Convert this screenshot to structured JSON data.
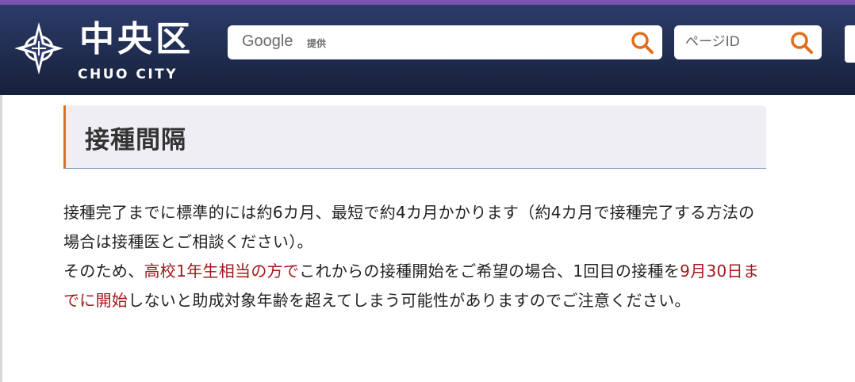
{
  "header": {
    "logo_kanji": "中央区",
    "logo_sub": "CHUO CITY",
    "search": {
      "google_label": "Google",
      "provided_label": "提供"
    },
    "page_id": {
      "placeholder": "ページID"
    }
  },
  "colors": {
    "accent_orange": "#e06e1e",
    "header_navy": "#1f2b4d",
    "stripe_purple": "#7b54b0",
    "emphasis_red": "#a3181c"
  },
  "main": {
    "heading": "接種間隔",
    "paragraph1": "接種完了までに標準的には約6カ月、最短で約4カ月かかります（約4カ月で接種完了する方法の場合は接種医とご相談ください）。",
    "paragraph2": {
      "p1": "そのため、",
      "em1": "高校1年生相当の方で",
      "p2": "これからの接種開始をご希望の場合、1回目の接種を",
      "em2": "9月30日までに開始",
      "p3": "しないと助成対象年齢を超えてしまう可能性がありますのでご注意ください。"
    }
  }
}
